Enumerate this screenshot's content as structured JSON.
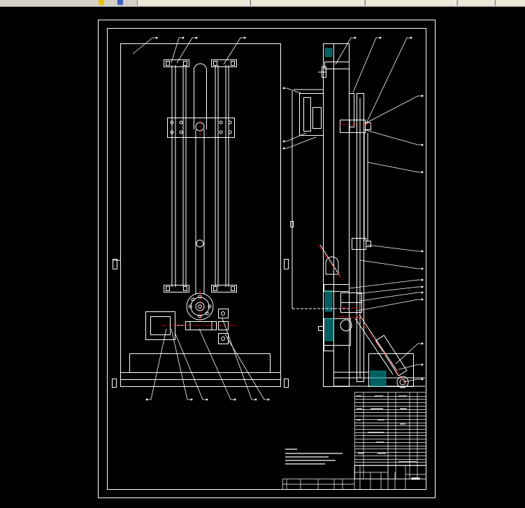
{
  "window": {
    "toolbar_segments": [
      "segment-1",
      "segment-2",
      "segment-3",
      "segment-4",
      "segment-5"
    ]
  },
  "drawing": {
    "background": "#000000",
    "line_color": "#ffffff",
    "centerline_color": "#ff0000",
    "hatch_color": "#00a0a0",
    "title_block_rows": 7,
    "bom_rows": 22,
    "leader_labels_left": 8,
    "leader_labels_right": 14,
    "leader_labels_bottom": 8
  }
}
